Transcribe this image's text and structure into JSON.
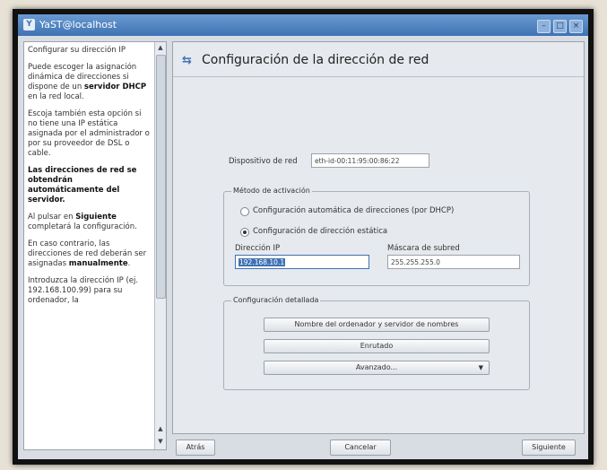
{
  "window": {
    "title": "YaST@localhost"
  },
  "help": {
    "paragraphs": [
      {
        "text": "Configurar su dirección IP"
      },
      {
        "text": "Puede escoger la asignación dinámica de direcciones si dispone de un ",
        "bold": "servidor DHCP",
        "after": " en la red local."
      },
      {
        "text": "Escoja también esta opción si no tiene una IP estática asignada por el administrador o por su proveedor de DSL o cable."
      },
      {
        "bold_only": "Las direcciones de red se obtendrán automáticamente del servidor."
      },
      {
        "text": "Al pulsar en ",
        "bold": "Siguiente",
        "after": " completará la configuración."
      },
      {
        "text": "En caso contrario, las direcciones de red deberán ser asignadas ",
        "bold": "manualmente",
        "after": "."
      },
      {
        "text": "Introduzca la dirección IP (ej. 192.168.100.99) para su ordenador, la"
      }
    ]
  },
  "header": {
    "title": "Configuración de la dirección de red"
  },
  "device": {
    "label": "Dispositivo de red",
    "value": "eth-id-00:11:95:00:86:22"
  },
  "method_group": {
    "title": "Método de activación",
    "option_dhcp": "Configuración automática de direcciones (por DHCP)",
    "option_static": "Configuración de dirección estática",
    "ip_label": "Dirección IP",
    "ip_value": "192.168.10.1",
    "mask_label": "Máscara de subred",
    "mask_value": "255.255.255.0"
  },
  "detail_group": {
    "title": "Configuración detallada",
    "host_button": "Nombre del ordenador y servidor de nombres",
    "routing_button": "Enrutado",
    "advanced_button": "Avanzado..."
  },
  "footer": {
    "back": "Atrás",
    "cancel": "Cancelar",
    "next": "Siguiente"
  }
}
